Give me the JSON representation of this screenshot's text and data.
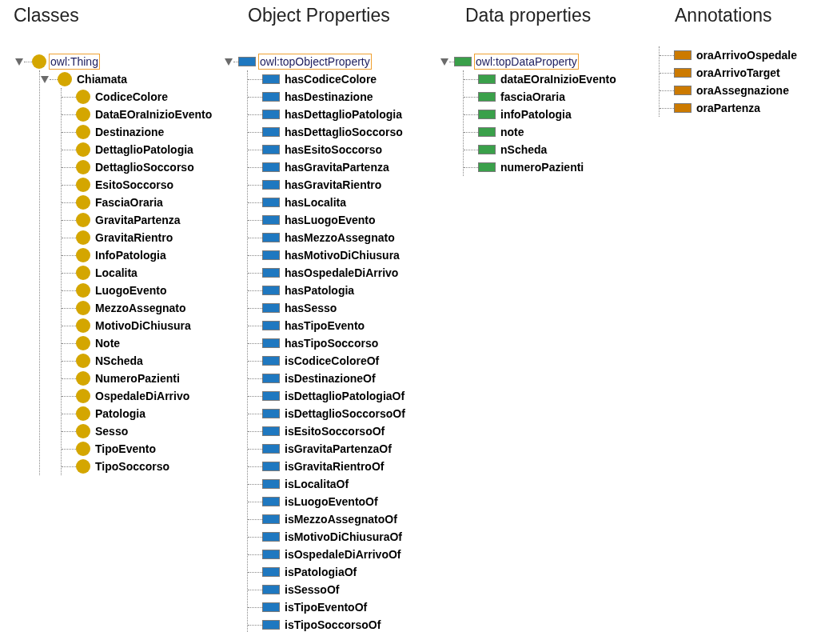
{
  "panels": [
    {
      "heading": "Classes",
      "tree": [
        {
          "label": "owl:Thing",
          "kind": "class",
          "selected": true,
          "expanded": true,
          "children": [
            {
              "label": "Chiamata",
              "kind": "class",
              "selected": false,
              "expanded": true,
              "children": [
                {
                  "label": "CodiceColore",
                  "kind": "class",
                  "selected": false
                },
                {
                  "label": "DataEOraInizioEvento",
                  "kind": "class",
                  "selected": false
                },
                {
                  "label": "Destinazione",
                  "kind": "class",
                  "selected": false
                },
                {
                  "label": "DettaglioPatologia",
                  "kind": "class",
                  "selected": false
                },
                {
                  "label": "DettaglioSoccorso",
                  "kind": "class",
                  "selected": false
                },
                {
                  "label": "EsitoSoccorso",
                  "kind": "class",
                  "selected": false
                },
                {
                  "label": "FasciaOraria",
                  "kind": "class",
                  "selected": false
                },
                {
                  "label": "GravitaPartenza",
                  "kind": "class",
                  "selected": false
                },
                {
                  "label": "GravitaRientro",
                  "kind": "class",
                  "selected": false
                },
                {
                  "label": "InfoPatologia",
                  "kind": "class",
                  "selected": false
                },
                {
                  "label": "Localita",
                  "kind": "class",
                  "selected": false
                },
                {
                  "label": "LuogoEvento",
                  "kind": "class",
                  "selected": false
                },
                {
                  "label": "MezzoAssegnato",
                  "kind": "class",
                  "selected": false
                },
                {
                  "label": "MotivoDiChiusura",
                  "kind": "class",
                  "selected": false
                },
                {
                  "label": "Note",
                  "kind": "class",
                  "selected": false
                },
                {
                  "label": "NScheda",
                  "kind": "class",
                  "selected": false
                },
                {
                  "label": "NumeroPazienti",
                  "kind": "class",
                  "selected": false
                },
                {
                  "label": "OspedaleDiArrivo",
                  "kind": "class",
                  "selected": false
                },
                {
                  "label": "Patologia",
                  "kind": "class",
                  "selected": false
                },
                {
                  "label": "Sesso",
                  "kind": "class",
                  "selected": false
                },
                {
                  "label": "TipoEvento",
                  "kind": "class",
                  "selected": false
                },
                {
                  "label": "TipoSoccorso",
                  "kind": "class",
                  "selected": false
                }
              ]
            }
          ]
        }
      ]
    },
    {
      "heading": "Object Properties",
      "tree": [
        {
          "label": "owl:topObjectProperty",
          "kind": "object",
          "selected": true,
          "expanded": true,
          "children": [
            {
              "label": "hasCodiceColore",
              "kind": "object",
              "selected": false
            },
            {
              "label": "hasDestinazione",
              "kind": "object",
              "selected": false
            },
            {
              "label": "hasDettaglioPatologia",
              "kind": "object",
              "selected": false
            },
            {
              "label": "hasDettaglioSoccorso",
              "kind": "object",
              "selected": false
            },
            {
              "label": "hasEsitoSoccorso",
              "kind": "object",
              "selected": false
            },
            {
              "label": "hasGravitaPartenza",
              "kind": "object",
              "selected": false
            },
            {
              "label": "hasGravitaRientro",
              "kind": "object",
              "selected": false
            },
            {
              "label": "hasLocalita",
              "kind": "object",
              "selected": false
            },
            {
              "label": "hasLuogoEvento",
              "kind": "object",
              "selected": false
            },
            {
              "label": "hasMezzoAssegnato",
              "kind": "object",
              "selected": false
            },
            {
              "label": "hasMotivoDiChiusura",
              "kind": "object",
              "selected": false
            },
            {
              "label": "hasOspedaleDiArrivo",
              "kind": "object",
              "selected": false
            },
            {
              "label": "hasPatologia",
              "kind": "object",
              "selected": false
            },
            {
              "label": "hasSesso",
              "kind": "object",
              "selected": false
            },
            {
              "label": "hasTipoEvento",
              "kind": "object",
              "selected": false
            },
            {
              "label": "hasTipoSoccorso",
              "kind": "object",
              "selected": false
            },
            {
              "label": "isCodiceColoreOf",
              "kind": "object",
              "selected": false
            },
            {
              "label": "isDestinazioneOf",
              "kind": "object",
              "selected": false
            },
            {
              "label": "isDettaglioPatologiaOf",
              "kind": "object",
              "selected": false
            },
            {
              "label": "isDettaglioSoccorsoOf",
              "kind": "object",
              "selected": false
            },
            {
              "label": "isEsitoSoccorsoOf",
              "kind": "object",
              "selected": false
            },
            {
              "label": "isGravitaPartenzaOf",
              "kind": "object",
              "selected": false
            },
            {
              "label": "isGravitaRientroOf",
              "kind": "object",
              "selected": false
            },
            {
              "label": "isLocalitaOf",
              "kind": "object",
              "selected": false
            },
            {
              "label": "isLuogoEventoOf",
              "kind": "object",
              "selected": false
            },
            {
              "label": "isMezzoAssegnatoOf",
              "kind": "object",
              "selected": false
            },
            {
              "label": "isMotivoDiChiusuraOf",
              "kind": "object",
              "selected": false
            },
            {
              "label": "isOspedaleDiArrivoOf",
              "kind": "object",
              "selected": false
            },
            {
              "label": "isPatologiaOf",
              "kind": "object",
              "selected": false
            },
            {
              "label": "isSessoOf",
              "kind": "object",
              "selected": false
            },
            {
              "label": "isTipoEventoOf",
              "kind": "object",
              "selected": false
            },
            {
              "label": "isTipoSoccorsoOf",
              "kind": "object",
              "selected": false
            }
          ]
        }
      ]
    },
    {
      "heading": "Data properties",
      "tree": [
        {
          "label": "owl:topDataProperty",
          "kind": "data",
          "selected": true,
          "expanded": true,
          "children": [
            {
              "label": "dataEOraInizioEvento",
              "kind": "data",
              "selected": false
            },
            {
              "label": "fasciaOraria",
              "kind": "data",
              "selected": false
            },
            {
              "label": "infoPatologia",
              "kind": "data",
              "selected": false
            },
            {
              "label": "note",
              "kind": "data",
              "selected": false
            },
            {
              "label": "nScheda",
              "kind": "data",
              "selected": false
            },
            {
              "label": "numeroPazienti",
              "kind": "data",
              "selected": false
            }
          ]
        }
      ]
    },
    {
      "heading": "Annotations",
      "list": [
        {
          "label": "oraArrivoOspedale",
          "kind": "annotation",
          "selected": false
        },
        {
          "label": "oraArrivoTarget",
          "kind": "annotation",
          "selected": false
        },
        {
          "label": "oraAssegnazione",
          "kind": "annotation",
          "selected": false
        },
        {
          "label": "oraPartenza",
          "kind": "annotation",
          "selected": false
        }
      ]
    }
  ]
}
